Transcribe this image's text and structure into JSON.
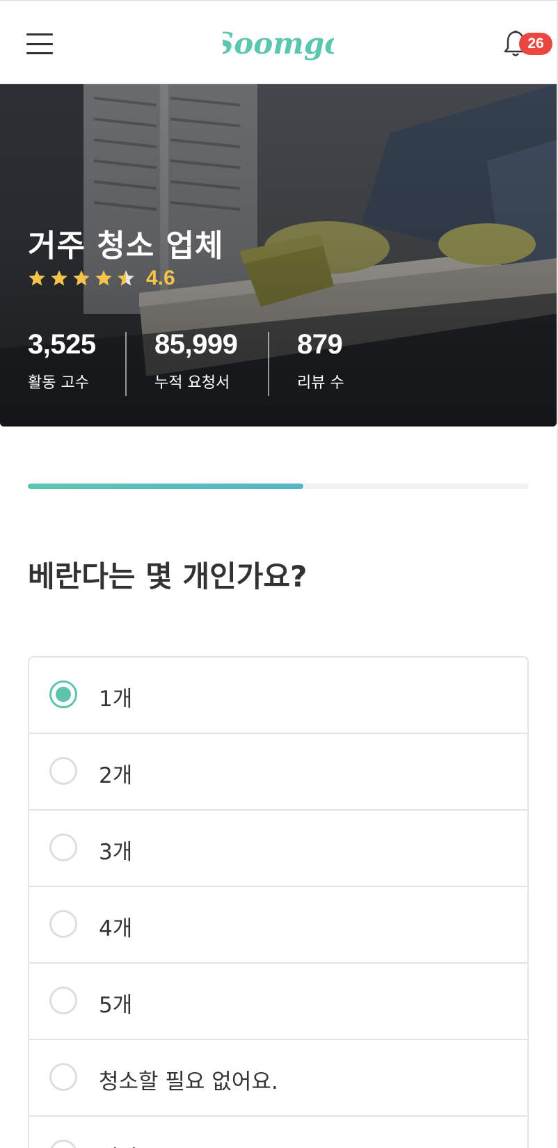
{
  "header": {
    "logo_text": "Soomgo",
    "menu_icon": "hamburger-menu-icon",
    "bell_icon": "bell-icon",
    "notification_count": "26",
    "brand_color": "#5cc6b0",
    "badge_color": "#e9473f"
  },
  "hero": {
    "title": "거주 청소 업체",
    "rating_value": "4.6",
    "rating_fraction": 0.92,
    "stats": [
      {
        "value": "3,525",
        "label": "활동 고수"
      },
      {
        "value": "85,999",
        "label": "누적 요청서"
      },
      {
        "value": "879",
        "label": "리뷰 수"
      }
    ]
  },
  "progress": {
    "fraction": 0.55,
    "color": "#5cc6b0"
  },
  "question": {
    "title": "베란다는 몇 개인가요?",
    "options": [
      {
        "label": "1개",
        "selected": true
      },
      {
        "label": "2개",
        "selected": false
      },
      {
        "label": "3개",
        "selected": false
      },
      {
        "label": "4개",
        "selected": false
      },
      {
        "label": "5개",
        "selected": false
      },
      {
        "label": "청소할 필요 없어요.",
        "selected": false
      },
      {
        "label": "기타",
        "selected": false
      }
    ]
  }
}
